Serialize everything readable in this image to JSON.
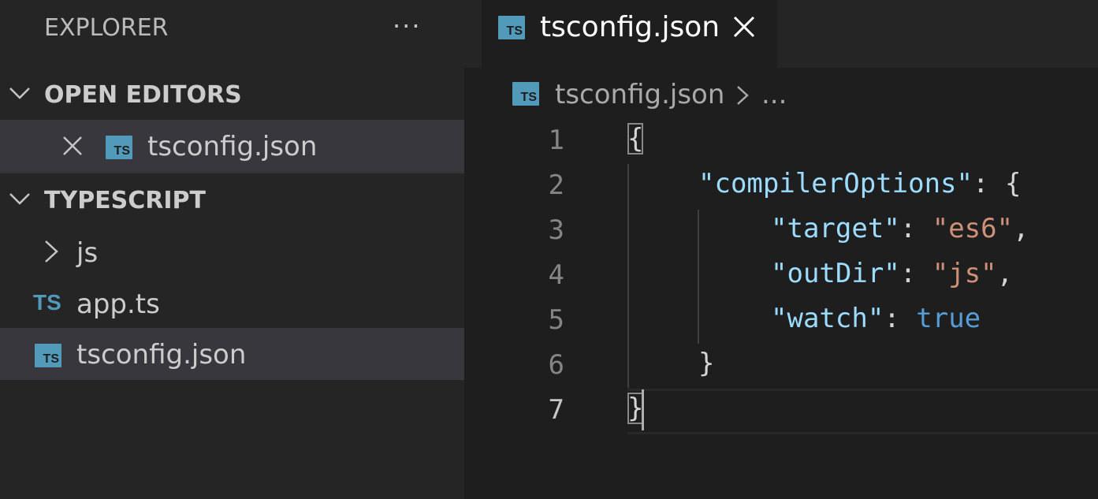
{
  "sidebar": {
    "title": "EXPLORER",
    "more_label": "···",
    "open_editors": {
      "label": "OPEN EDITORS",
      "items": [
        {
          "label": "tsconfig.json",
          "icon": "ts-file-icon"
        }
      ]
    },
    "workspace": {
      "label": "TYPESCRIPT",
      "items": [
        {
          "label": "js",
          "type": "folder",
          "icon": "chevron-right-icon"
        },
        {
          "label": "app.ts",
          "type": "file",
          "icon_text": "TS"
        },
        {
          "label": "tsconfig.json",
          "type": "file",
          "icon_text": "TS",
          "selected": true
        }
      ]
    }
  },
  "editor": {
    "tab": {
      "label": "tsconfig.json",
      "icon_text": "TS"
    },
    "breadcrumb": {
      "file": "tsconfig.json",
      "ellipsis": "..."
    },
    "line_numbers": [
      "1",
      "2",
      "3",
      "4",
      "5",
      "6",
      "7"
    ],
    "active_line": "7",
    "code": {
      "l1": "{",
      "l2_key": "\"compilerOptions\"",
      "l2_rest": ": {",
      "l3_key": "\"target\"",
      "l3_sep": ": ",
      "l3_val": "\"es6\"",
      "l3_end": ",",
      "l4_key": "\"outDir\"",
      "l4_sep": ": ",
      "l4_val": "\"js\"",
      "l4_end": ",",
      "l5_key": "\"watch\"",
      "l5_sep": ": ",
      "l5_val": "true",
      "l6": "}",
      "l7": "}"
    }
  },
  "colors": {
    "ts_icon": "#519aba",
    "json_key": "#9cdcfe",
    "json_string": "#ce9178",
    "json_keyword": "#569cd6"
  }
}
